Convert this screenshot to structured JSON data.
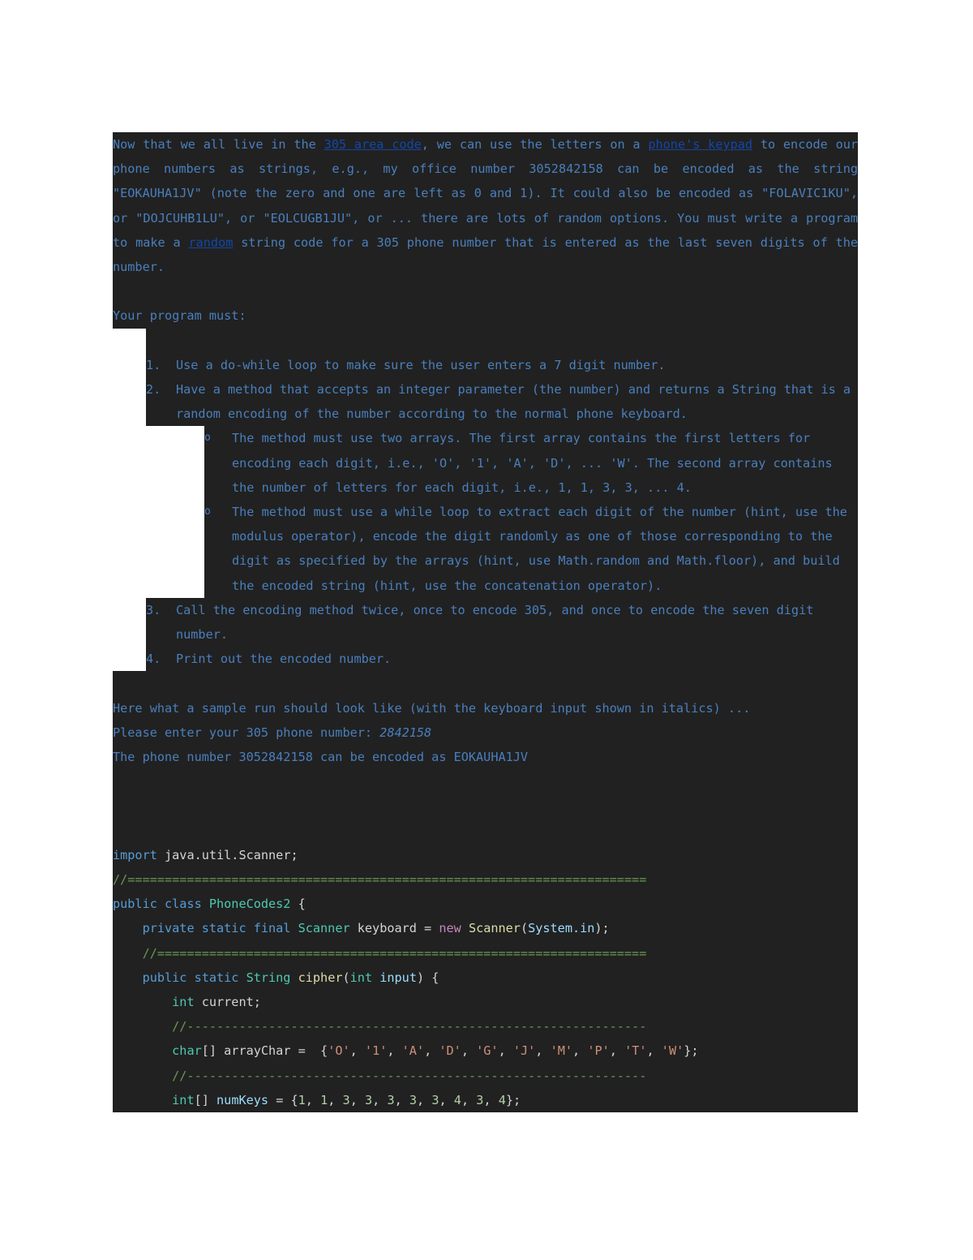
{
  "document": {
    "colors": {
      "selection_background": "#212121",
      "body_text": "#4a7fbd",
      "hyperlink": "#1347a8",
      "page_background": "#ffffff"
    },
    "intro": {
      "line1_a": "Now that we all live in the ",
      "link_area_code": "305 area code",
      "line1_b": ", we can use the letters on a ",
      "link_keypad": "phone's keypad",
      "line1_c": " to encode our phone numbers as strings, e.g., my office number 3052842158 can be encoded as the string \"EOKAUHA1JV\" (note the zero and one are left as 0 and 1). It could also be encoded as \"FOLAVIC1KU\", or \"DOJCUHB1LU\", or \"EOLCUGB1JU\", or ... there are lots of random options. You must write a program to make a ",
      "link_random": "random",
      "line1_d": " string code for a 305 phone number that is entered as the last seven digits of the number."
    },
    "requirements_heading": "Your program must:",
    "requirements": [
      {
        "marker": "1.",
        "text": "Use a do-while loop to make sure the user enters a 7 digit number."
      },
      {
        "marker": "2.",
        "text": "Have a method that accepts an integer parameter (the number) and returns a String that is a random encoding of the number according to the normal phone keyboard.",
        "subitems": [
          {
            "marker": "o",
            "text": "The method must use two arrays. The first array contains the first letters for encoding each digit, i.e., 'O', '1', 'A', 'D', ... 'W'. The second array contains the number of letters for each digit, i.e., 1, 1, 3, 3, ... 4."
          },
          {
            "marker": "o",
            "text": "The method must use a while loop to extract each digit of the number (hint, use the modulus operator), encode the digit randomly as one of those corresponding to the digit as specified by the arrays (hint, use Math.random and Math.floor), and build the encoded string (hint, use the concatenation operator)."
          }
        ]
      },
      {
        "marker": "3.",
        "text": "Call the encoding method twice, once to encode 305, and once to encode the seven digit number."
      },
      {
        "marker": "4.",
        "text": "Print out the encoded number."
      }
    ],
    "sample_run": {
      "caption": "Here what a sample run should look like (with the keyboard input shown in italics) ...",
      "prompt": "Please enter your 305 phone number: ",
      "input_italic": "2842158",
      "output": "The phone number 3052842158 can be encoded as EOKAUHA1JV"
    },
    "code": {
      "language": "java",
      "class_name": "PhoneCodes2",
      "lines": [
        {
          "tokens": [
            {
              "t": "import",
              "c": "k"
            },
            {
              "t": " java.util.Scanner;",
              "c": "pl"
            }
          ]
        },
        {
          "tokens": [
            {
              "t": "//======================================================================",
              "c": "cm"
            }
          ]
        },
        {
          "tokens": [
            {
              "t": "public class ",
              "c": "k"
            },
            {
              "t": "PhoneCodes2",
              "c": "ty"
            },
            {
              "t": " {",
              "c": "pl"
            }
          ]
        },
        {
          "tokens": [
            {
              "t": "    ",
              "c": "pl"
            },
            {
              "t": "private static final ",
              "c": "k"
            },
            {
              "t": "Scanner",
              "c": "ty"
            },
            {
              "t": " keyboard = ",
              "c": "pl"
            },
            {
              "t": "new ",
              "c": "op"
            },
            {
              "t": "Scanner",
              "c": "fn"
            },
            {
              "t": "(",
              "c": "pl"
            },
            {
              "t": "System.in",
              "c": "va"
            },
            {
              "t": ");",
              "c": "pl"
            }
          ]
        },
        {
          "tokens": [
            {
              "t": "    //==================================================================",
              "c": "cm"
            }
          ]
        },
        {
          "tokens": [
            {
              "t": "    ",
              "c": "pl"
            },
            {
              "t": "public static ",
              "c": "k"
            },
            {
              "t": "String",
              "c": "ty"
            },
            {
              "t": " ",
              "c": "pl"
            },
            {
              "t": "cipher",
              "c": "fn"
            },
            {
              "t": "(",
              "c": "pl"
            },
            {
              "t": "int",
              "c": "ty"
            },
            {
              "t": " ",
              "c": "pl"
            },
            {
              "t": "input",
              "c": "va"
            },
            {
              "t": ") {",
              "c": "pl"
            }
          ]
        },
        {
          "tokens": [
            {
              "t": "        ",
              "c": "pl"
            },
            {
              "t": "int",
              "c": "ty"
            },
            {
              "t": " current;",
              "c": "pl"
            }
          ]
        },
        {
          "tokens": [
            {
              "t": "        //--------------------------------------------------------------",
              "c": "cm"
            }
          ]
        },
        {
          "tokens": [
            {
              "t": "        ",
              "c": "pl"
            },
            {
              "t": "char",
              "c": "ty"
            },
            {
              "t": "[] arrayChar =  {",
              "c": "pl"
            },
            {
              "t": "'O'",
              "c": "st"
            },
            {
              "t": ", ",
              "c": "pl"
            },
            {
              "t": "'1'",
              "c": "st"
            },
            {
              "t": ", ",
              "c": "pl"
            },
            {
              "t": "'A'",
              "c": "st"
            },
            {
              "t": ", ",
              "c": "pl"
            },
            {
              "t": "'D'",
              "c": "st"
            },
            {
              "t": ", ",
              "c": "pl"
            },
            {
              "t": "'G'",
              "c": "st"
            },
            {
              "t": ", ",
              "c": "pl"
            },
            {
              "t": "'J'",
              "c": "st"
            },
            {
              "t": ", ",
              "c": "pl"
            },
            {
              "t": "'M'",
              "c": "st"
            },
            {
              "t": ", ",
              "c": "pl"
            },
            {
              "t": "'P'",
              "c": "st"
            },
            {
              "t": ", ",
              "c": "pl"
            },
            {
              "t": "'T'",
              "c": "st"
            },
            {
              "t": ", ",
              "c": "pl"
            },
            {
              "t": "'W'",
              "c": "st"
            },
            {
              "t": "};",
              "c": "pl"
            }
          ]
        },
        {
          "tokens": [
            {
              "t": "        //--------------------------------------------------------------",
              "c": "cm"
            }
          ]
        },
        {
          "tokens": [
            {
              "t": "        ",
              "c": "pl"
            },
            {
              "t": "int",
              "c": "ty"
            },
            {
              "t": "[] ",
              "c": "pl"
            },
            {
              "t": "numKeys",
              "c": "va"
            },
            {
              "t": " = {",
              "c": "pl"
            },
            {
              "t": "1",
              "c": "nu"
            },
            {
              "t": ", ",
              "c": "pl"
            },
            {
              "t": "1",
              "c": "nu"
            },
            {
              "t": ", ",
              "c": "pl"
            },
            {
              "t": "3",
              "c": "nu"
            },
            {
              "t": ", ",
              "c": "pl"
            },
            {
              "t": "3",
              "c": "nu"
            },
            {
              "t": ", ",
              "c": "pl"
            },
            {
              "t": "3",
              "c": "nu"
            },
            {
              "t": ", ",
              "c": "pl"
            },
            {
              "t": "3",
              "c": "nu"
            },
            {
              "t": ", ",
              "c": "pl"
            },
            {
              "t": "3",
              "c": "nu"
            },
            {
              "t": ", ",
              "c": "pl"
            },
            {
              "t": "4",
              "c": "nu"
            },
            {
              "t": ", ",
              "c": "pl"
            },
            {
              "t": "3",
              "c": "nu"
            },
            {
              "t": ", ",
              "c": "pl"
            },
            {
              "t": "4",
              "c": "nu"
            },
            {
              "t": "};",
              "c": "pl"
            }
          ]
        }
      ]
    }
  }
}
